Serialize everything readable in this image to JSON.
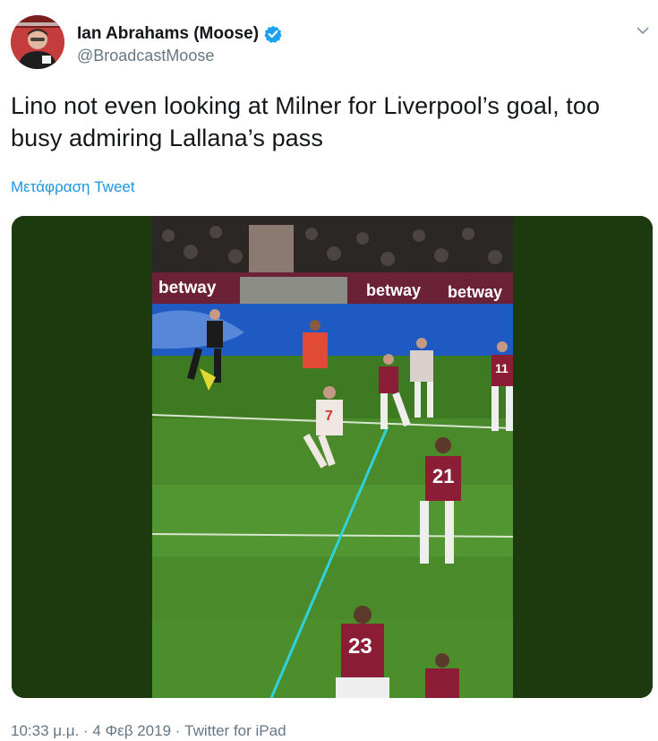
{
  "user": {
    "display_name": "Ian Abrahams (Moose)",
    "handle": "@BroadcastMoose",
    "verified": true,
    "avatar_icon": "profile-photo"
  },
  "tweet": {
    "text": "Lino not even looking at Milner for Liverpool’s goal, too busy admiring Lallana’s pass",
    "translate_label": "Μετάφραση Tweet"
  },
  "media": {
    "ads": [
      "betway",
      "betway",
      "betway"
    ],
    "shirt_numbers": [
      "7",
      "11",
      "21",
      "23"
    ]
  },
  "meta": {
    "timestamp": "10:33 μ.μ. · 4 Φεβ 2019 · Twitter for iPad"
  },
  "colors": {
    "accent": "#1b95e0",
    "secondary_text": "#657786",
    "media_background": "#1c3a0e",
    "offside_line": "#2fd1dc"
  }
}
